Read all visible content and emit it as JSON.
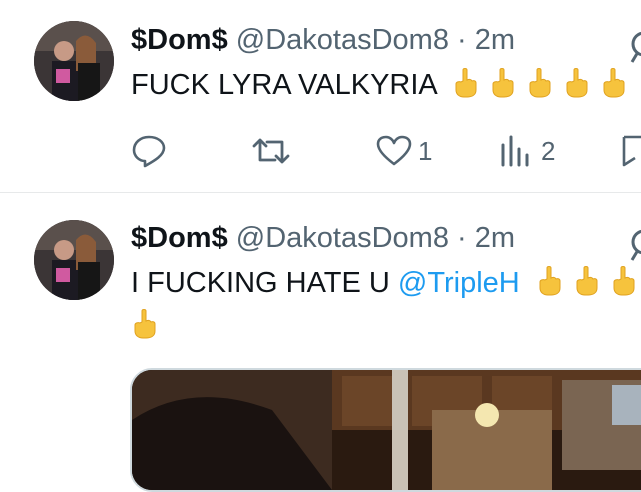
{
  "tweets": [
    {
      "display_name": "$Dom$",
      "handle": "@DakotasDom8",
      "separator": "·",
      "time": "2m",
      "text": "FUCK LYRA VALKYRIA",
      "emoji_count": 5,
      "stats": {
        "reply": "",
        "retweet": "",
        "like": "1",
        "views": "2"
      }
    },
    {
      "display_name": "$Dom$",
      "handle": "@DakotasDom8",
      "separator": "·",
      "time": "2m",
      "text": "I FUCKING HATE U ",
      "mention": "@TripleH",
      "emoji_count": 4,
      "has_media": true
    }
  ],
  "colors": {
    "text": "#0f1419",
    "secondary": "#536471",
    "link": "#1d9bf0",
    "divider": "#e7e9ea"
  },
  "icons": [
    "reply-icon",
    "retweet-icon",
    "like-icon",
    "views-icon",
    "bookmark-icon",
    "grok-icon",
    "middle-finger-emoji"
  ]
}
